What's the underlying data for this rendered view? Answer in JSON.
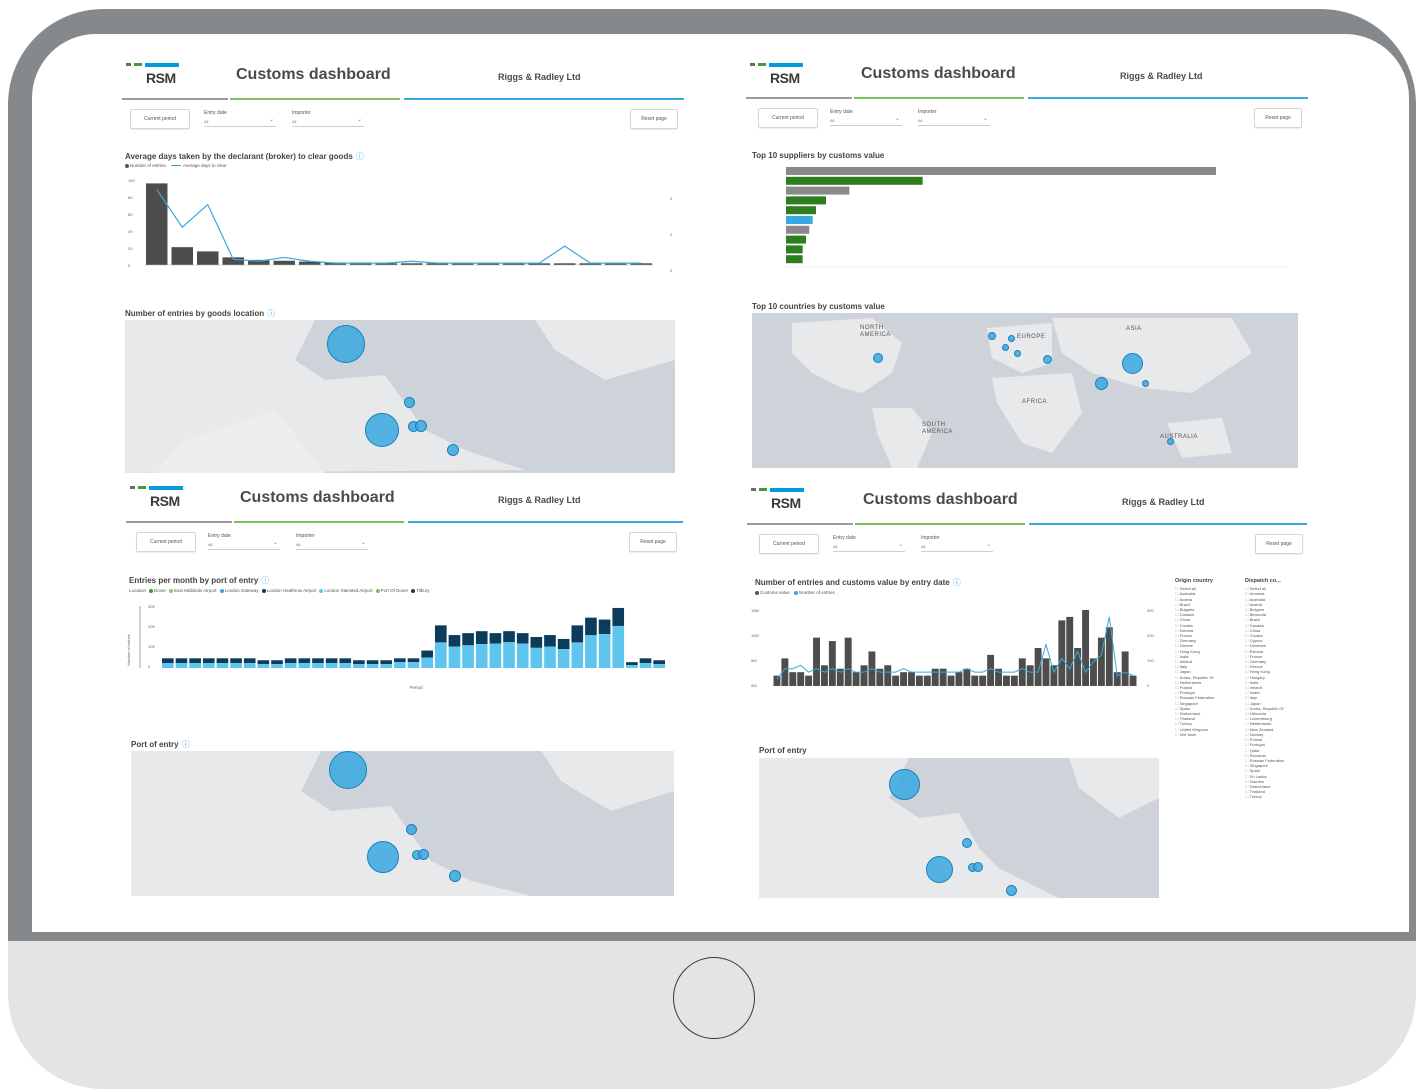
{
  "brand": {
    "logo_text": "RSM",
    "title": "Customs dashboard",
    "client": "Riggs & Radley Ltd"
  },
  "controls": {
    "current_period": "Current period",
    "reset_page": "Reset page",
    "entry_date_label": "Entry date",
    "importer_label": "Importer",
    "all": "All"
  },
  "panel1": {
    "chart_title": "Average days taken by the declarant (broker) to clear goods",
    "legend_entries": "Number of entries",
    "legend_days": "Average days to clear",
    "map_title": "Number of entries by goods location"
  },
  "panel2": {
    "chart_title": "Top 10 suppliers by customs value",
    "map_title": "Top 10 countries by customs value",
    "continents": [
      "NORTH AMERICA",
      "EUROPE",
      "ASIA",
      "AFRICA",
      "SOUTH AMERICA",
      "AUSTRALIA"
    ]
  },
  "panel3": {
    "chart_title": "Entries per month by port of entry",
    "legend_label": "Location",
    "locations": [
      "Dover",
      "East Midlands Airport",
      "London Gateway",
      "London Heathrow Airport",
      "London Stansted Airport",
      "Port Of Dover",
      "Tilbury"
    ],
    "location_colors": [
      "#3f9c35",
      "#8ccf6a",
      "#38a8e0",
      "#0c3c5c",
      "#5ec6ee",
      "#7cc05a",
      "#333333"
    ],
    "y_axis_label": "Number of entries",
    "x_axis_label": "Period",
    "map_title": "Port of entry"
  },
  "panel4": {
    "chart_title": "Number of entries and customs value by entry date",
    "legend_value": "Customs value",
    "legend_entries": "Number of entries",
    "map_title": "Port of entry",
    "origin_header": "Origin country",
    "dispatch_header": "Dispatch co...",
    "origin_countries": [
      "Select all",
      "Australia",
      "Austria",
      "Brazil",
      "Bulgaria",
      "Canada",
      "China",
      "Croatia",
      "Estonia",
      "France",
      "Germany",
      "Greece",
      "Hong Kong",
      "India",
      "Ireland",
      "Italy",
      "Japan",
      "Korea, Republic Of",
      "Netherlands",
      "Poland",
      "Portugal",
      "Russian Federation",
      "Singapore",
      "Spain",
      "Switzerland",
      "Thailand",
      "Turkey",
      "United Kingdom",
      "Viet Nam"
    ],
    "dispatch_countries": [
      "Select all",
      "Armenia",
      "Australia",
      "Austria",
      "Belgium",
      "Bermuda",
      "Brazil",
      "Canada",
      "China",
      "Croatia",
      "Cyprus",
      "Denmark",
      "Estonia",
      "France",
      "Germany",
      "Greece",
      "Hong Kong",
      "Hungary",
      "India",
      "Ireland",
      "Israel",
      "Italy",
      "Japan",
      "Korea, Republic Of",
      "Lithuania",
      "Luxembourg",
      "Netherlands",
      "New Zealand",
      "Norway",
      "Poland",
      "Portugal",
      "Qatar",
      "Romania",
      "Russian Federation",
      "Singapore",
      "Spain",
      "Sri Lanka",
      "Sweden",
      "Switzerland",
      "Thailand",
      "Turkey"
    ]
  },
  "chart_data": [
    {
      "type": "bar",
      "title": "Average days taken by the declarant (broker) to clear goods",
      "series": [
        {
          "name": "Number of entries",
          "values": [
            96,
            21,
            16,
            9,
            6,
            5,
            4,
            3,
            3,
            2,
            2,
            2,
            2,
            2,
            2,
            2,
            2,
            2,
            2,
            2
          ]
        },
        {
          "name": "Average days to clear",
          "values": [
            4,
            2,
            3.2,
            0.3,
            0.2,
            0.4,
            0.2,
            0.1,
            0.1,
            0.1,
            0.2,
            0.1,
            0.1,
            0.1,
            0.1,
            0.1,
            1.0,
            0.1,
            0.1,
            0.1
          ]
        }
      ],
      "ylim": [
        0,
        100
      ],
      "y_ticks": [
        "100",
        "80",
        "60",
        "40",
        "20",
        "0"
      ],
      "y2_ticks": [
        "4",
        "2",
        "0"
      ]
    },
    {
      "type": "bar",
      "title": "Top 10 suppliers by customs value",
      "values": [
        12.9,
        4.1,
        1.9,
        1.2,
        0.9,
        0.8,
        0.7,
        0.6,
        0.5,
        0.5
      ],
      "colors": [
        "#8a8a8a",
        "#2e7d1f",
        "#8a8a8a",
        "#2e7d1f",
        "#2e7d1f",
        "#38a8e0",
        "#8a8a8a",
        "#2e7d1f",
        "#2e7d1f",
        "#2e7d1f"
      ],
      "xlim": [
        0,
        15
      ]
    },
    {
      "type": "bar",
      "title": "Entries per month by port of entry",
      "values": [
        5,
        5,
        5,
        5,
        5,
        5,
        5,
        4,
        4,
        5,
        5,
        5,
        5,
        5,
        4,
        4,
        4,
        5,
        5,
        9,
        22,
        17,
        18,
        19,
        18,
        19,
        18,
        16,
        17,
        15,
        22,
        26,
        25,
        31,
        3,
        5,
        4
      ],
      "light_fraction": [
        0.5,
        0.5,
        0.5,
        0.5,
        0.5,
        0.5,
        0.5,
        0.5,
        0.5,
        0.5,
        0.5,
        0.5,
        0.5,
        0.5,
        0.5,
        0.5,
        0.5,
        0.6,
        0.6,
        0.6,
        0.6,
        0.65,
        0.65,
        0.65,
        0.7,
        0.7,
        0.7,
        0.65,
        0.65,
        0.65,
        0.6,
        0.65,
        0.7,
        0.7,
        0.5,
        0.5,
        0.5
      ],
      "y_ticks": [
        "30K",
        "20K",
        "10K",
        "0"
      ]
    },
    {
      "type": "bar",
      "title": "Number of entries and customs value by entry date",
      "values": [
        3,
        8,
        4,
        4,
        3,
        14,
        6,
        13,
        5,
        14,
        4,
        6,
        10,
        5,
        6,
        3,
        4,
        4,
        3,
        3,
        5,
        5,
        3,
        4,
        5,
        3,
        3,
        9,
        5,
        3,
        3,
        8,
        6,
        11,
        8,
        6,
        19,
        20,
        11,
        22,
        8,
        14,
        17,
        4,
        10,
        3
      ],
      "line": [
        2,
        5,
        5,
        6,
        4,
        5,
        4,
        5,
        4,
        5,
        4,
        4,
        5,
        4,
        4,
        4,
        5,
        4,
        4,
        4,
        4,
        4,
        4,
        4,
        5,
        4,
        4,
        5,
        4,
        4,
        4,
        5,
        4,
        4,
        12,
        4,
        8,
        5,
        10,
        4,
        7,
        9,
        20,
        3,
        4,
        3
      ],
      "y_ticks": [
        "15M",
        "10M",
        "5M",
        "0M"
      ],
      "y2_ticks": [
        "300",
        "200",
        "100",
        "0"
      ]
    }
  ]
}
